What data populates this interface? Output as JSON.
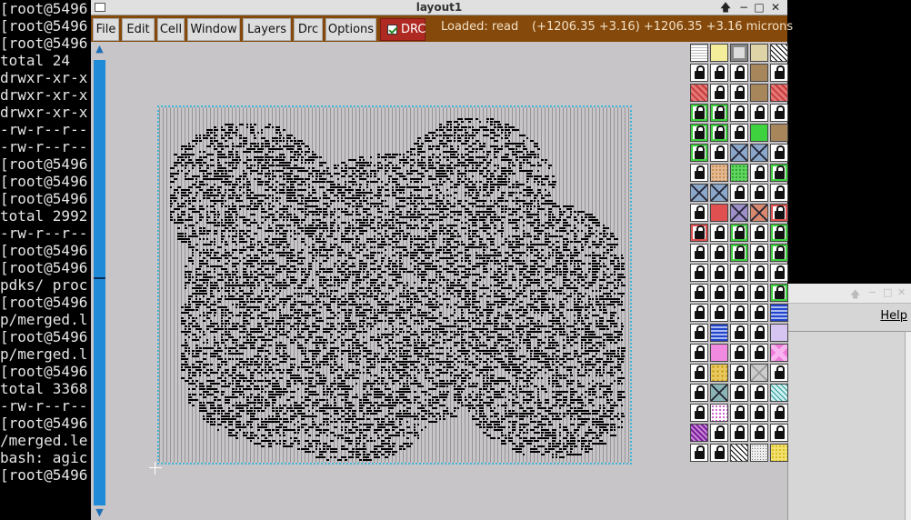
{
  "terminal": {
    "lines": [
      "[root@5496",
      "[root@5496",
      "[root@5496",
      "total 24",
      "drwxr-xr-x",
      "drwxr-xr-x",
      "drwxr-xr-x",
      "-rw-r--r--",
      "-rw-r--r--",
      "[root@5496",
      "[root@5496",
      "[root@5496",
      "total 2992",
      "-rw-r--r--",
      "[root@5496",
      "[root@5496",
      "pdks/ proc",
      "[root@5496",
      "p/merged.l",
      "[root@5496",
      "p/merged.l",
      "[root@5496",
      "total 3368",
      "-rw-r--r--",
      "[root@5496",
      "/merged.le",
      "bash: agic",
      "[root@5496"
    ]
  },
  "layout_window": {
    "title": "layout1",
    "controls": {
      "up": "🡅",
      "minimize": "−",
      "maximize": "□",
      "close": "✕"
    }
  },
  "menubar": {
    "menus": [
      "File",
      "Edit",
      "Cell",
      "Window",
      "Layers",
      "Drc",
      "Options"
    ],
    "drc_label": "DRC",
    "drc_checked": true,
    "status_loaded": "Loaded: read",
    "coordinates": "(+1206.35 +3.16) +1206.35 +3.16 microns"
  },
  "scrollbar": {
    "up_arrow": "▲",
    "down_arrow": "▼"
  },
  "help_window": {
    "menu_help": "Help",
    "controls": {
      "up": "🡅",
      "minimize": "−",
      "maximize": "□",
      "close": "✕"
    }
  },
  "colors": {
    "menubar_bg": "#85490c",
    "drc_bg": "#b02a24",
    "die_outline": "#3bb6d8",
    "scroll_track": "#1f8bd8"
  },
  "layers": [
    [
      "grid-white",
      "yellow-stipple",
      "gray-box",
      "tan",
      "diag-dark"
    ],
    [
      "lock",
      "lock",
      "lock",
      "tan-solid",
      "lock"
    ],
    [
      "red-diag",
      "lock",
      "lock",
      "tan-solid",
      "red-diag"
    ],
    [
      "lock-green",
      "lock-green",
      "lock",
      "lock",
      "lock"
    ],
    [
      "lock-green",
      "lock-green",
      "lock",
      "green-solid",
      "tan-solid"
    ],
    [
      "lock-green",
      "lock",
      "cross-blue",
      "cross-blue",
      "lock"
    ],
    [
      "lock",
      "tan-dot",
      "green-dot",
      "lock",
      "lock-green"
    ],
    [
      "cross-blue",
      "cross-blue",
      "lock",
      "lock",
      "lock"
    ],
    [
      "lock",
      "red-solid",
      "cross-purple",
      "cross-red",
      "lock-red"
    ],
    [
      "lock-red",
      "lock",
      "lock-green",
      "lock",
      "lock-green"
    ],
    [
      "lock",
      "lock",
      "lock-green",
      "lock",
      "lock-green"
    ],
    [
      "lock",
      "lock",
      "lock",
      "lock",
      "lock"
    ],
    [
      "lock",
      "lock",
      "lock",
      "lock",
      "lock-green"
    ],
    [
      "lock",
      "lock",
      "lock",
      "lock",
      "blue-wave"
    ],
    [
      "lock",
      "blue-wave",
      "lock",
      "lock",
      "lavender"
    ],
    [
      "lock",
      "pink-solid",
      "lock",
      "lock",
      "pink-cross"
    ],
    [
      "lock",
      "yellow-pattern",
      "lock",
      "gray-cross",
      "lock"
    ],
    [
      "lock",
      "cross-dark",
      "lock",
      "lock",
      "teal-diag"
    ],
    [
      "lock",
      "purple-dot",
      "lock",
      "lock",
      "lock"
    ],
    [
      "purple-diag",
      "lock",
      "lock",
      "lock",
      "lock"
    ],
    [
      "lock",
      "lock",
      "diag-dark",
      "gray-dot",
      "yellow-dot"
    ]
  ]
}
